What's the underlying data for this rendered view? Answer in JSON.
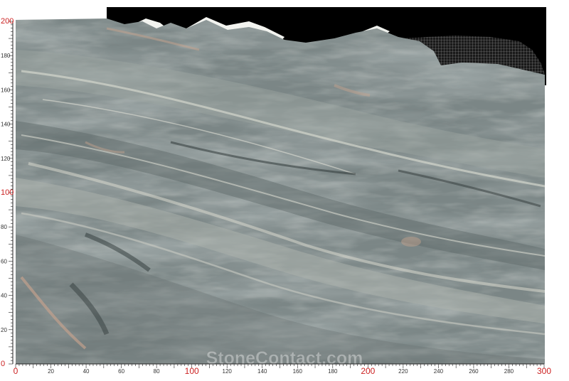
{
  "photo": {
    "subject": "marble-slab",
    "colors": {
      "stone_base": "#7b8686",
      "stone_light": "#b9bdb6",
      "stone_dark": "#4c5757",
      "vein_warm": "#c8a38e",
      "background_top": "#000000",
      "page": "#ffffff"
    }
  },
  "watermark": {
    "text": "StoneContact.com"
  },
  "ruler": {
    "x_max": 300,
    "y_max": 200,
    "x_ticks": [
      {
        "label": "0",
        "value": 0,
        "highlight": true
      },
      {
        "label": "20",
        "value": 20,
        "highlight": false
      },
      {
        "label": "40",
        "value": 40,
        "highlight": false
      },
      {
        "label": "60",
        "value": 60,
        "highlight": false
      },
      {
        "label": "80",
        "value": 80,
        "highlight": false
      },
      {
        "label": "100",
        "value": 100,
        "highlight": true
      },
      {
        "label": "120",
        "value": 120,
        "highlight": false
      },
      {
        "label": "140",
        "value": 140,
        "highlight": false
      },
      {
        "label": "160",
        "value": 160,
        "highlight": false
      },
      {
        "label": "180",
        "value": 180,
        "highlight": false
      },
      {
        "label": "200",
        "value": 200,
        "highlight": true
      },
      {
        "label": "220",
        "value": 220,
        "highlight": false
      },
      {
        "label": "240",
        "value": 240,
        "highlight": false
      },
      {
        "label": "260",
        "value": 260,
        "highlight": false
      },
      {
        "label": "280",
        "value": 280,
        "highlight": false
      },
      {
        "label": "300",
        "value": 300,
        "highlight": true
      }
    ],
    "y_ticks": [
      {
        "label": "0",
        "value": 0,
        "highlight": true
      },
      {
        "label": "20",
        "value": 20,
        "highlight": false
      },
      {
        "label": "40",
        "value": 40,
        "highlight": false
      },
      {
        "label": "60",
        "value": 60,
        "highlight": false
      },
      {
        "label": "80",
        "value": 80,
        "highlight": false
      },
      {
        "label": "100",
        "value": 100,
        "highlight": true
      },
      {
        "label": "120",
        "value": 120,
        "highlight": false
      },
      {
        "label": "140",
        "value": 140,
        "highlight": false
      },
      {
        "label": "160",
        "value": 160,
        "highlight": false
      },
      {
        "label": "180",
        "value": 180,
        "highlight": false
      },
      {
        "label": "200",
        "value": 200,
        "highlight": true
      }
    ],
    "colors": {
      "tick": "#222222",
      "label": "#333333",
      "highlight": "#cc2222"
    }
  }
}
